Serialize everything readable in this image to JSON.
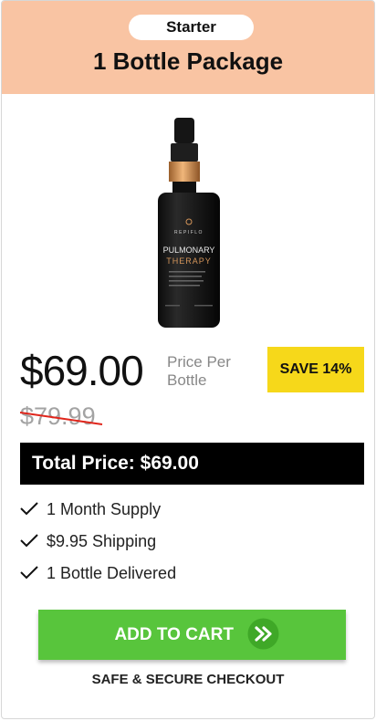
{
  "header": {
    "tier": "Starter",
    "title": "1 Bottle Package"
  },
  "product": {
    "brand": "REPIFLO",
    "name_line1": "PULMONARY",
    "name_line2": "THERAPY"
  },
  "pricing": {
    "price": "$69.00",
    "price_per_label": "Price Per Bottle",
    "save_badge": "SAVE 14%",
    "old_price": "$79.99",
    "total_label": "Total Price: $69.00"
  },
  "features": [
    {
      "label": "1 Month Supply",
      "icon": "check-icon"
    },
    {
      "label": "$9.95 Shipping",
      "icon": "check-icon"
    },
    {
      "label": "1 Bottle Delivered",
      "icon": "check-icon"
    }
  ],
  "cta": {
    "label": "ADD TO CART",
    "icon": "double-chevron-right-icon",
    "secure_text": "SAFE & SECURE CHECKOUT"
  },
  "colors": {
    "header_bg": "#f9c4a3",
    "badge_bg": "#f6d81a",
    "button_bg": "#58c53c",
    "strike": "#e0261c",
    "bottle_cap": "#d4955a"
  }
}
